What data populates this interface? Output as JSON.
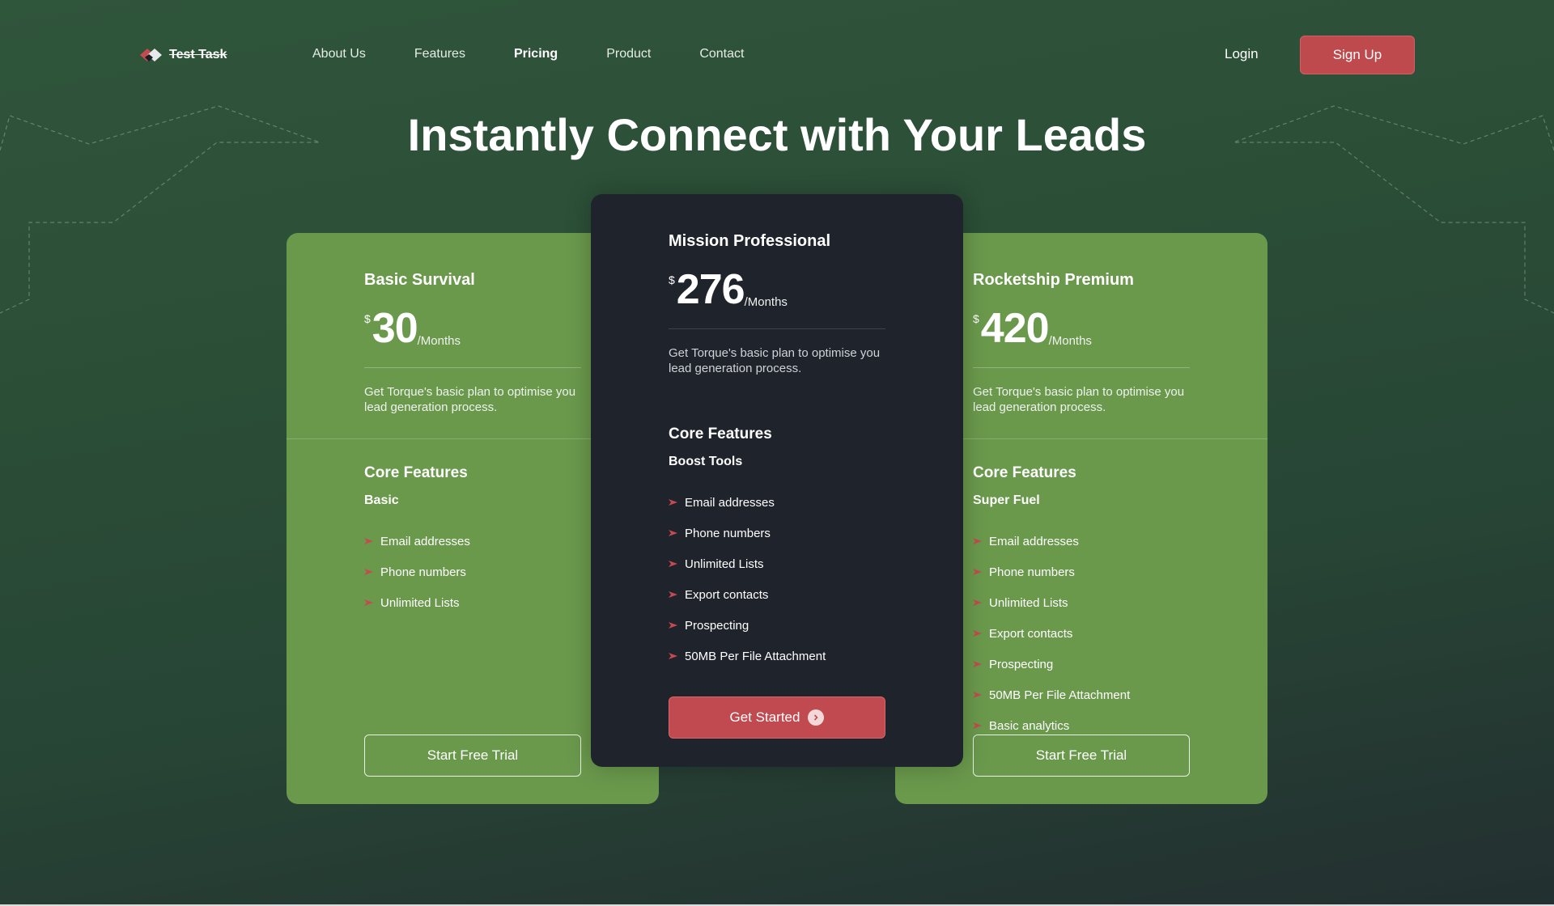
{
  "header": {
    "logo_text": "Test Task",
    "nav": [
      {
        "label": "About Us",
        "active": false
      },
      {
        "label": "Features",
        "active": false
      },
      {
        "label": "Pricing",
        "active": true
      },
      {
        "label": "Product",
        "active": false
      },
      {
        "label": "Contact",
        "active": false
      }
    ],
    "login_label": "Login",
    "signup_label": "Sign Up"
  },
  "hero": {
    "title": "Instantly Connect with Your Leads"
  },
  "plans": [
    {
      "name": "Basic Survival",
      "currency": "$",
      "price": "30",
      "period": "/Months",
      "description": "Get Torque's basic plan to optimise you lead generation process.",
      "core_title": "Core Features",
      "tier": "Basic",
      "features": [
        "Email addresses",
        "Phone numbers",
        "Unlimited Lists"
      ],
      "button": "Start Free Trial"
    },
    {
      "name": "Mission Professional",
      "currency": "$",
      "price": "276",
      "period": "/Months",
      "description": "Get Torque's basic plan to optimise you lead generation process.",
      "core_title": "Core Features",
      "tier": "Boost Tools",
      "features": [
        "Email addresses",
        "Phone numbers",
        "Unlimited Lists",
        "Export contacts",
        "Prospecting",
        "50MB Per File Attachment"
      ],
      "button": "Get Started"
    },
    {
      "name": "Rocketship Premium",
      "currency": "$",
      "price": "420",
      "period": "/Months",
      "description": "Get Torque's basic plan to optimise you lead generation process.",
      "core_title": "Core Features",
      "tier": "Super Fuel",
      "features": [
        "Email addresses",
        "Phone numbers",
        "Unlimited Lists",
        "Export contacts",
        "Prospecting",
        "50MB Per File Attachment",
        "Basic analytics"
      ],
      "button": "Start Free Trial"
    }
  ],
  "colors": {
    "accent": "#bf4a4e",
    "card_green": "#6a994c",
    "card_dark": "#1f232b",
    "background": "#2b4e37"
  }
}
